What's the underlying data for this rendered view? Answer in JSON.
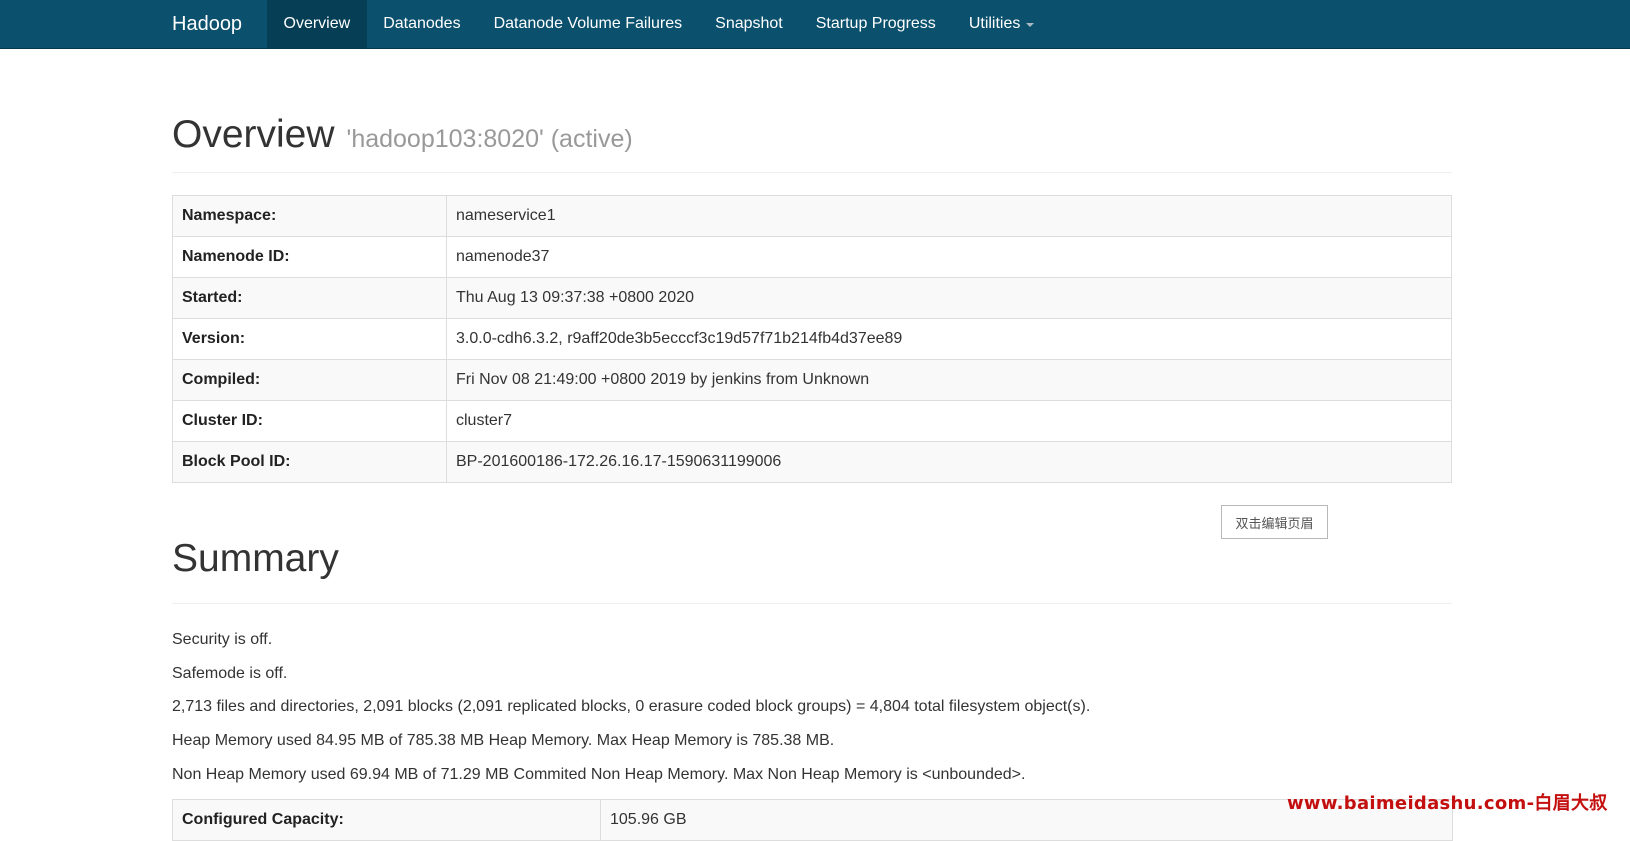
{
  "navbar": {
    "brand": "Hadoop",
    "items": [
      {
        "label": "Overview",
        "active": true
      },
      {
        "label": "Datanodes"
      },
      {
        "label": "Datanode Volume Failures"
      },
      {
        "label": "Snapshot"
      },
      {
        "label": "Startup Progress"
      },
      {
        "label": "Utilities",
        "has_dropdown": true
      }
    ],
    "background_color": "#0b506d"
  },
  "overview": {
    "title": "Overview",
    "subtitle": "'hadoop103:8020' (active)",
    "rows": [
      {
        "label": "Namespace:",
        "value": "nameservice1"
      },
      {
        "label": "Namenode ID:",
        "value": "namenode37"
      },
      {
        "label": "Started:",
        "value": "Thu Aug 13 09:37:38 +0800 2020"
      },
      {
        "label": "Version:",
        "value": "3.0.0-cdh6.3.2, r9aff20de3b5ecccf3c19d57f71b214fb4d37ee89"
      },
      {
        "label": "Compiled:",
        "value": "Fri Nov 08 21:49:00 +0800 2019 by jenkins from Unknown"
      },
      {
        "label": "Cluster ID:",
        "value": "cluster7"
      },
      {
        "label": "Block Pool ID:",
        "value": "BP-201600186-172.26.16.17-1590631199006"
      }
    ]
  },
  "edit_header_button": "双击编辑页眉",
  "summary": {
    "title": "Summary",
    "lines": [
      "Security is off.",
      "Safemode is off.",
      "2,713 files and directories, 2,091 blocks (2,091 replicated blocks, 0 erasure coded block groups) = 4,804 total filesystem object(s).",
      "Heap Memory used 84.95 MB of 785.38 MB Heap Memory. Max Heap Memory is 785.38 MB.",
      "Non Heap Memory used 69.94 MB of 71.29 MB Commited Non Heap Memory. Max Non Heap Memory is <unbounded>."
    ],
    "capacity": {
      "label": "Configured Capacity:",
      "value": "105.96 GB"
    }
  },
  "watermark": "www.baimeidashu.com-白眉大叔"
}
